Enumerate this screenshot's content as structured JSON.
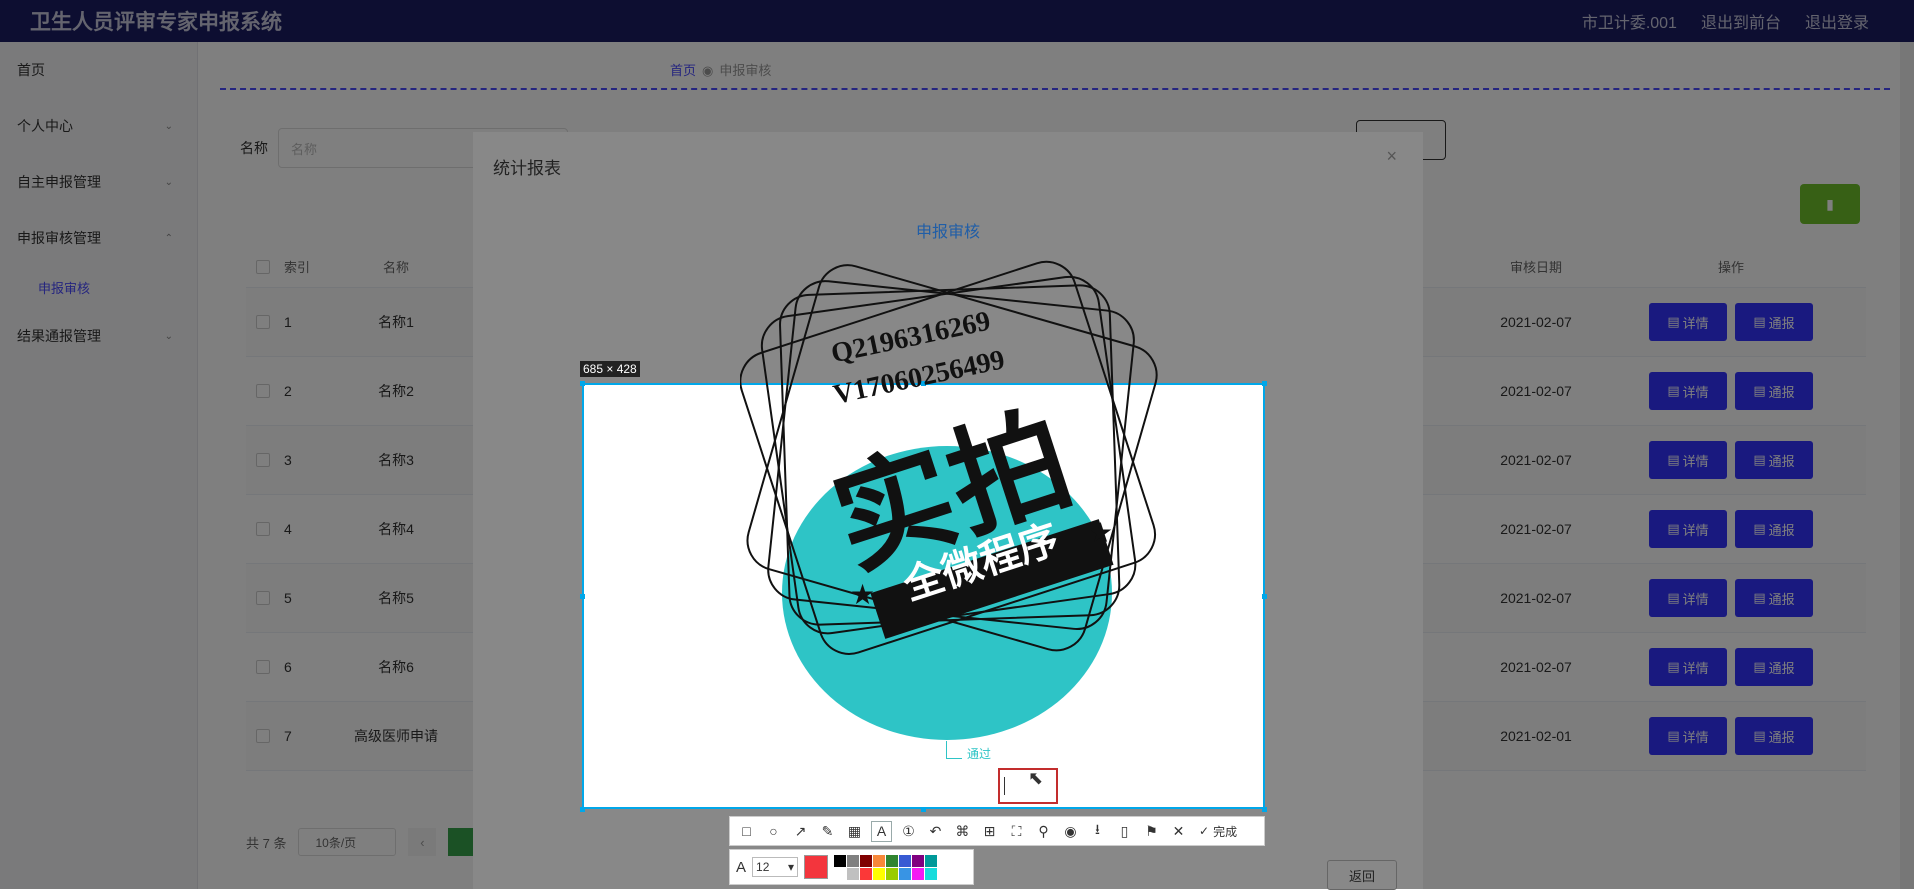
{
  "topbar": {
    "title": "卫生人员评审专家申报系统",
    "user": "市卫计委.001",
    "back": "退出到前台",
    "logout": "退出登录"
  },
  "sidebar": {
    "items": [
      {
        "label": "首页"
      },
      {
        "label": "个人中心"
      },
      {
        "label": "自主申报管理"
      },
      {
        "label": "申报审核管理"
      }
    ],
    "sub": "申报审核",
    "last": "结果通报管理"
  },
  "breadcrumb": {
    "home": "首页",
    "current": "申报审核"
  },
  "filter": {
    "label": "名称",
    "placeholder": "名称"
  },
  "table": {
    "headers": {
      "index": "索引",
      "name": "名称",
      "date": "审核日期",
      "ops": "操作"
    },
    "rows": [
      {
        "idx": "1",
        "name": "名称1",
        "date": "2021-02-07"
      },
      {
        "idx": "2",
        "name": "名称2",
        "date": "2021-02-07"
      },
      {
        "idx": "3",
        "name": "名称3",
        "date": "2021-02-07"
      },
      {
        "idx": "4",
        "name": "名称4",
        "date": "2021-02-07"
      },
      {
        "idx": "5",
        "name": "名称5",
        "date": "2021-02-07"
      },
      {
        "idx": "6",
        "name": "名称6",
        "date": "2021-02-07"
      },
      {
        "idx": "7",
        "name": "高级医师申请",
        "date": "2021-02-01"
      }
    ],
    "btn_detail": "详情",
    "btn_report": "通报"
  },
  "pager": {
    "total": "共 7 条",
    "size": "10条/页"
  },
  "dialog": {
    "title": "统计报表",
    "close": "×",
    "subtitle": "申报审核",
    "return": "返回"
  },
  "capture": {
    "size": "685 × 428",
    "pie_label": "通过"
  },
  "watermark": {
    "line1": "Q2196316269",
    "line2": "V17060256499",
    "big": "实拍",
    "banner": "全微程序"
  },
  "toolbar": {
    "done": "完成",
    "font_size": "12"
  },
  "colors": {
    "accent": "#3333ff",
    "pie": "#2ec4c6",
    "palette": [
      "#000000",
      "#808080",
      "#800000",
      "#f7883a",
      "#308430",
      "#385ad3",
      "#800080",
      "#009999",
      "#ffffff",
      "#c0c0c0",
      "#fb3838",
      "#ffff00",
      "#99cc00",
      "#3894e4",
      "#f31bf3",
      "#16dcdc"
    ]
  }
}
